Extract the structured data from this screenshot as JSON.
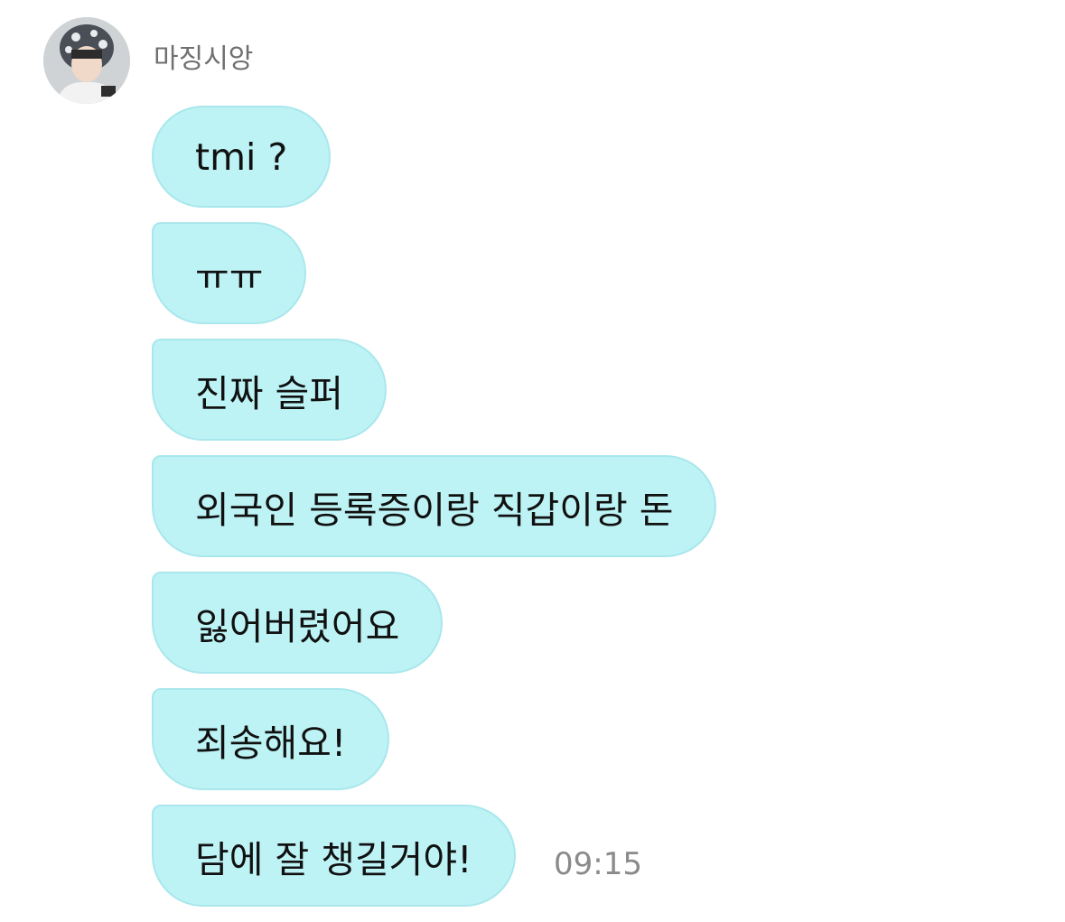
{
  "chat": {
    "sender": {
      "name": "마징시앙",
      "avatar_icon": "user-avatar-photo"
    },
    "messages": [
      {
        "text": "tmi ?"
      },
      {
        "text": "ㅠㅠ"
      },
      {
        "text": "진짜 슬퍼"
      },
      {
        "text": "외국인 등록증이랑 직갑이랑 돈"
      },
      {
        "text": "잃어버렸어요"
      },
      {
        "text": "죄송해요!"
      },
      {
        "text": "담에 잘 챙길거야!"
      }
    ],
    "timestamp": "09:15"
  },
  "colors": {
    "bubble_background": "#bdf3f5",
    "bubble_border": "#a9e7ec",
    "name_text": "#6f6f6f",
    "timestamp_text": "#8a8a8a"
  }
}
